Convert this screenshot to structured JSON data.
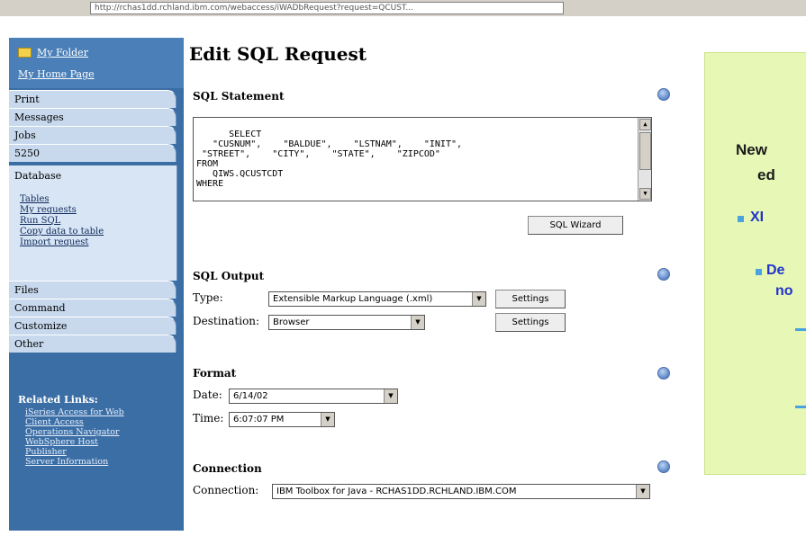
{
  "browser": {
    "address": "http://rchas1dd.rchland.ibm.com/webaccess/iWADbRequest?request=QCUST..."
  },
  "sidebar": {
    "folder_link": "My Folder",
    "home_link": "My Home Page",
    "tabs": [
      "Print",
      "Messages",
      "Jobs",
      "5250",
      "Database",
      "Files",
      "Command",
      "Customize",
      "Other"
    ],
    "database_items": [
      "Tables",
      "My requests",
      "Run SQL",
      "Copy data to table",
      "Import request"
    ],
    "related_title": "Related Links:",
    "related_links": [
      "iSeries Access for Web",
      "Client Access",
      "Operations Navigator",
      "WebSphere Host",
      "Publisher",
      "Server Information"
    ]
  },
  "page": {
    "title": "Edit SQL Request"
  },
  "sql_statement": {
    "heading": "SQL Statement",
    "text": "SELECT\n   \"CUSNUM\",    \"BALDUE\",    \"LSTNAM\",    \"INIT\",\n \"STREET\",    \"CITY\",    \"STATE\",    \"ZIPCOD\"\nFROM\n   QIWS.QCUSTCDT\nWHERE",
    "wizard_button": "SQL Wizard"
  },
  "sql_output": {
    "heading": "SQL Output",
    "type_label": "Type:",
    "type_value": "Extensible Markup Language (.xml)",
    "destination_label": "Destination:",
    "destination_value": "Browser",
    "settings_button": "Settings"
  },
  "format": {
    "heading": "Format",
    "date_label": "Date:",
    "date_value": "6/14/02",
    "time_label": "Time:",
    "time_value": "6:07:07 PM"
  },
  "connection": {
    "heading": "Connection",
    "label": "Connection:",
    "value": "IBM Toolbox for Java - RCHAS1DD.RCHLAND.IBM.COM"
  },
  "callout": {
    "line1": "New",
    "line2": "ed",
    "bullet1": "XI",
    "bullet2_a": "De",
    "bullet2_b": "no"
  },
  "colors": {
    "sidebar": "#3b6ea5",
    "callout_bg": "#e6f7b6",
    "callout_text": "#2233cc",
    "bullet": "#4aa3e0"
  }
}
